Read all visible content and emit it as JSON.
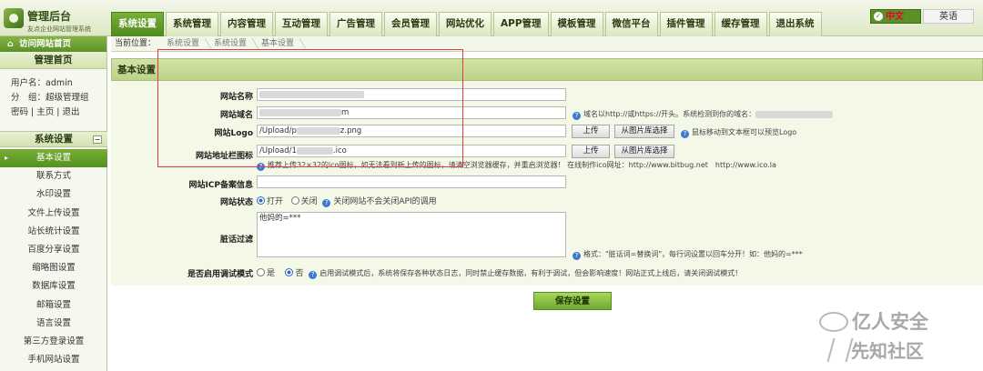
{
  "logo": {
    "title": "管理后台",
    "subtitle": "友点企业网站管理系统"
  },
  "nav": {
    "tabs": [
      "系统设置",
      "系统管理",
      "内容管理",
      "互动管理",
      "广告管理",
      "会员管理",
      "网站优化",
      "APP管理",
      "模板管理",
      "微信平台",
      "插件管理",
      "缓存管理",
      "退出系统"
    ],
    "active": "系统设置"
  },
  "lang": {
    "cn": "中文",
    "en": "英语"
  },
  "sidebar": {
    "home_link": "访问网站首页",
    "title": "管理首页",
    "user_label": "用户名：admin",
    "group_label": "分　组：超级管理组",
    "links": "密码 | 主页 | 退出",
    "section": "系统设置",
    "section_toggle": "−",
    "items": [
      "基本设置",
      "联系方式",
      "水印设置",
      "文件上传设置",
      "站长统计设置",
      "百度分享设置",
      "缩略图设置",
      "数据库设置",
      "邮箱设置",
      "语言设置",
      "第三方登录设置",
      "手机网站设置"
    ]
  },
  "breadcrumb": {
    "lead": "当前位置：",
    "parts": [
      "系统设置",
      "系统设置",
      "基本设置"
    ]
  },
  "panel": {
    "title": "基本设置"
  },
  "form": {
    "site_name": {
      "label": "网站名称"
    },
    "site_domain": {
      "label": "网站域名",
      "value_tail": "m",
      "hint": "域名以http://或https://开头。系统检测到你的域名："
    },
    "site_logo": {
      "label": "网站Logo",
      "value_head": "/Upload/p",
      "value_tail": "z.png",
      "upload": "上传",
      "pick": "从图片库选择",
      "hint": "鼠标移动到文本框可以预览Logo"
    },
    "site_icon": {
      "label": "网站地址栏图标",
      "value_head": "/Upload/1",
      "value_tail": ".ico",
      "upload": "上传",
      "pick": "从图片库选择",
      "hint": "推荐上传32×32的ico图标，如无法看到新上传的图标，请清空浏览器缓存，并重启浏览器！ 在线制作ico网址：http://www.bitbug.net　http://www.ico.la"
    },
    "icp": {
      "label": "网站ICP备案信息"
    },
    "status": {
      "label": "网站状态",
      "open": "打开",
      "close": "关闭",
      "hint": "关闭网站不会关闭API的调用"
    },
    "filter": {
      "label": "脏话过滤",
      "value": "他妈的=***",
      "hint": "格式：\"脏话词=替换词\"，每行词设置以回车分开！如：他妈的=***"
    },
    "debug": {
      "label": "是否启用调试模式",
      "yes": "是",
      "no": "否",
      "hint": "启用调试模式后，系统将保存各种状态日志，同时禁止缓存数据，有利于调试，但会影响速度！网站正式上线后，请关闭调试模式！"
    }
  },
  "save_button": "保存设置",
  "watermark": {
    "line1": "亿人安全",
    "line2": "先知社区"
  }
}
